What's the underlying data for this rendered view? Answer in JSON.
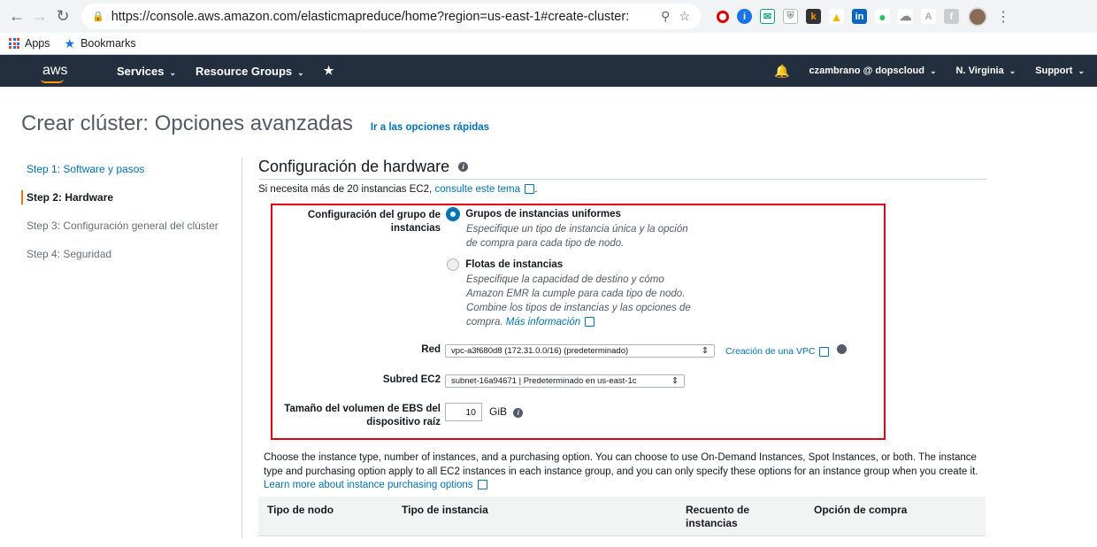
{
  "browser": {
    "url": "https://console.aws.amazon.com/elasticmapreduce/home?region=us-east-1#create-cluster:",
    "bookmarks": {
      "apps": "Apps",
      "bookmarks": "Bookmarks"
    }
  },
  "aws_nav": {
    "logo": "aws",
    "services": "Services",
    "resource_groups": "Resource Groups",
    "user": "czambrano @ dopscloud",
    "region": "N. Virginia",
    "support": "Support"
  },
  "page": {
    "title": "Crear clúster: Opciones avanzadas",
    "quick_options_link": "Ir a las opciones rápidas"
  },
  "steps": [
    {
      "label": "Step 1: Software y pasos",
      "state": "link"
    },
    {
      "label": "Step 2: Hardware",
      "state": "active"
    },
    {
      "label": "Step 3: Configuración general del clúster",
      "state": "disabled"
    },
    {
      "label": "Step 4: Seguridad",
      "state": "disabled"
    }
  ],
  "hardware": {
    "section_title": "Configuración de hardware",
    "note_prefix": "Si necesita más de 20 instancias EC2,",
    "note_link": "consulte este tema",
    "note_suffix": ".",
    "instance_group_config_label_1": "Configuración del grupo de",
    "instance_group_config_label_2": "instancias",
    "option_uniform": {
      "title": "Grupos de instancias uniformes",
      "desc_1": "Especifique un tipo de instancia única y la opción",
      "desc_2": "de compra para cada tipo de nodo.",
      "selected": true
    },
    "option_fleets": {
      "title": "Flotas de instancias",
      "desc_1": "Especifique la capacidad de destino y cómo",
      "desc_2": "Amazon EMR la cumple para cada tipo de nodo.",
      "desc_3": "Combine los tipos de instancias y las opciones de",
      "desc_4": "compra.",
      "link": "Más información",
      "selected": false
    },
    "network_label": "Red",
    "network_value": "vpc-a3f680d8 (172.31.0.0/16) (predeterminado)",
    "create_vpc_link": "Creación de una VPC",
    "subnet_label": "Subred EC2",
    "subnet_value": "subnet-16a94671 | Predeterminado en us-east-1c",
    "ebs_label_1": "Tamaño del volumen de EBS del",
    "ebs_label_2": "dispositivo raíz",
    "ebs_value": "10",
    "ebs_unit": "GiB"
  },
  "description": {
    "text": "Choose the instance type, number of instances, and a purchasing option. You can choose to use On-Demand Instances, Spot Instances, or both. The instance type and purchasing option apply to all EC2 instances in each instance group, and you can only specify these options for an instance group when you create it.",
    "link": "Learn more about instance purchasing options"
  },
  "table": {
    "headers": [
      "Tipo de nodo",
      "Tipo de instancia",
      "Recuento de instancias",
      "Opción de compra"
    ]
  }
}
